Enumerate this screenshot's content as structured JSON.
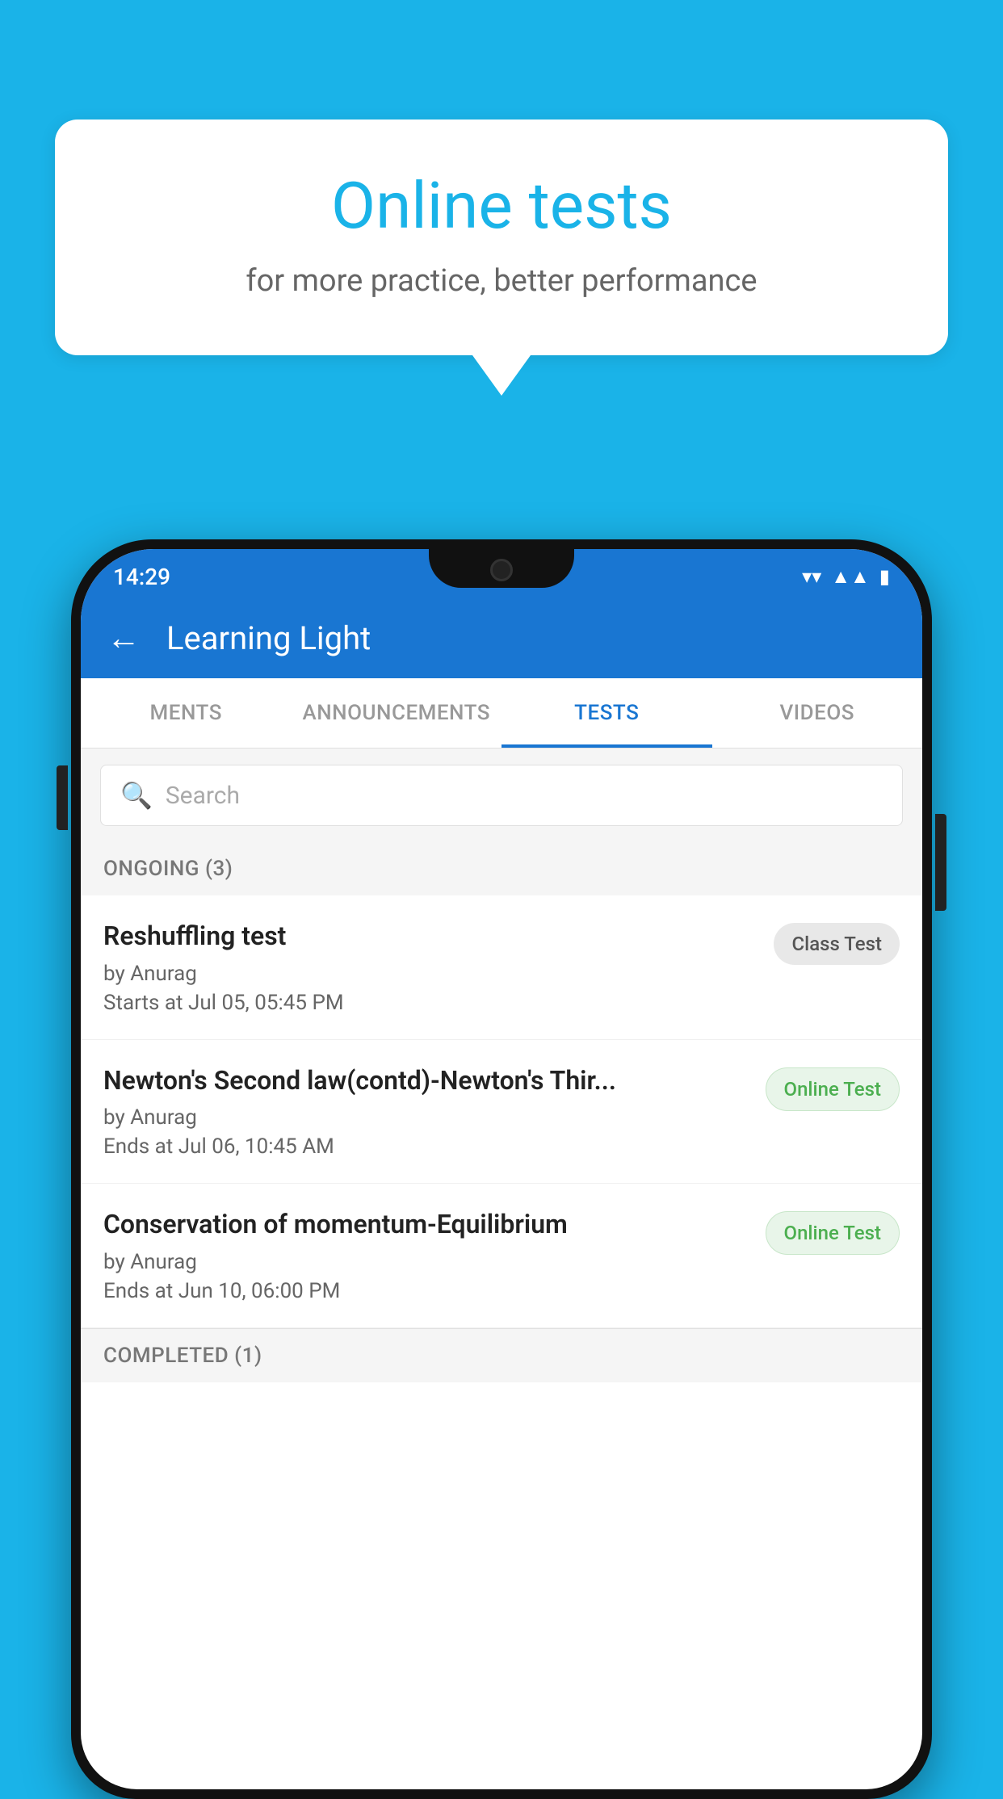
{
  "background_color": "#1ab3e8",
  "speech_bubble": {
    "title": "Online tests",
    "subtitle": "for more practice, better performance"
  },
  "phone": {
    "status_bar": {
      "time": "14:29",
      "wifi": "▼",
      "signal": "▲",
      "battery": "▮"
    },
    "header": {
      "back_label": "←",
      "title": "Learning Light"
    },
    "tabs": [
      {
        "label": "MENTS",
        "active": false
      },
      {
        "label": "ANNOUNCEMENTS",
        "active": false
      },
      {
        "label": "TESTS",
        "active": true
      },
      {
        "label": "VIDEOS",
        "active": false
      }
    ],
    "search": {
      "placeholder": "Search"
    },
    "ongoing_section": {
      "title": "ONGOING (3)"
    },
    "tests": [
      {
        "name": "Reshuffling test",
        "author": "by Anurag",
        "date": "Starts at  Jul 05, 05:45 PM",
        "badge": "Class Test",
        "badge_type": "class"
      },
      {
        "name": "Newton's Second law(contd)-Newton's Thir...",
        "author": "by Anurag",
        "date": "Ends at  Jul 06, 10:45 AM",
        "badge": "Online Test",
        "badge_type": "online"
      },
      {
        "name": "Conservation of momentum-Equilibrium",
        "author": "by Anurag",
        "date": "Ends at  Jun 10, 06:00 PM",
        "badge": "Online Test",
        "badge_type": "online"
      }
    ],
    "completed_section": {
      "title": "COMPLETED (1)"
    }
  }
}
